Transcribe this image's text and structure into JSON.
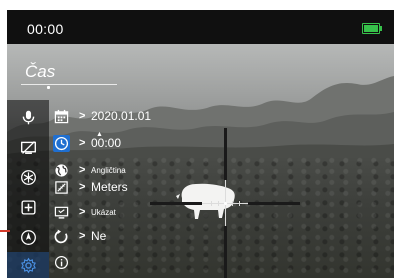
{
  "status": {
    "time": "00:00",
    "battery_color": "#37c24b"
  },
  "page": {
    "title": "Čas"
  },
  "sidebar": {
    "items": [
      {
        "icon": "microphone-icon"
      },
      {
        "icon": "display-off-icon"
      },
      {
        "icon": "snowflake-icon"
      },
      {
        "icon": "add-box-icon"
      },
      {
        "icon": "compass-icon"
      },
      {
        "icon": "gear-icon",
        "active": true
      }
    ]
  },
  "menu": {
    "rows": [
      {
        "icon": "calendar-icon",
        "value": "2020.01.01"
      },
      {
        "icon": "clock-icon",
        "value": "00:00",
        "active": true
      },
      {
        "icon": "globe-icon",
        "value": "Angličtina"
      },
      {
        "icon": "ruler-icon",
        "value": "Meters"
      },
      {
        "icon": "screen-icon",
        "value": "Ukázat"
      },
      {
        "icon": "reset-icon",
        "value": "Ne"
      },
      {
        "icon": "info-icon",
        "value": ""
      }
    ]
  },
  "accent_color": "#1f6fd0"
}
